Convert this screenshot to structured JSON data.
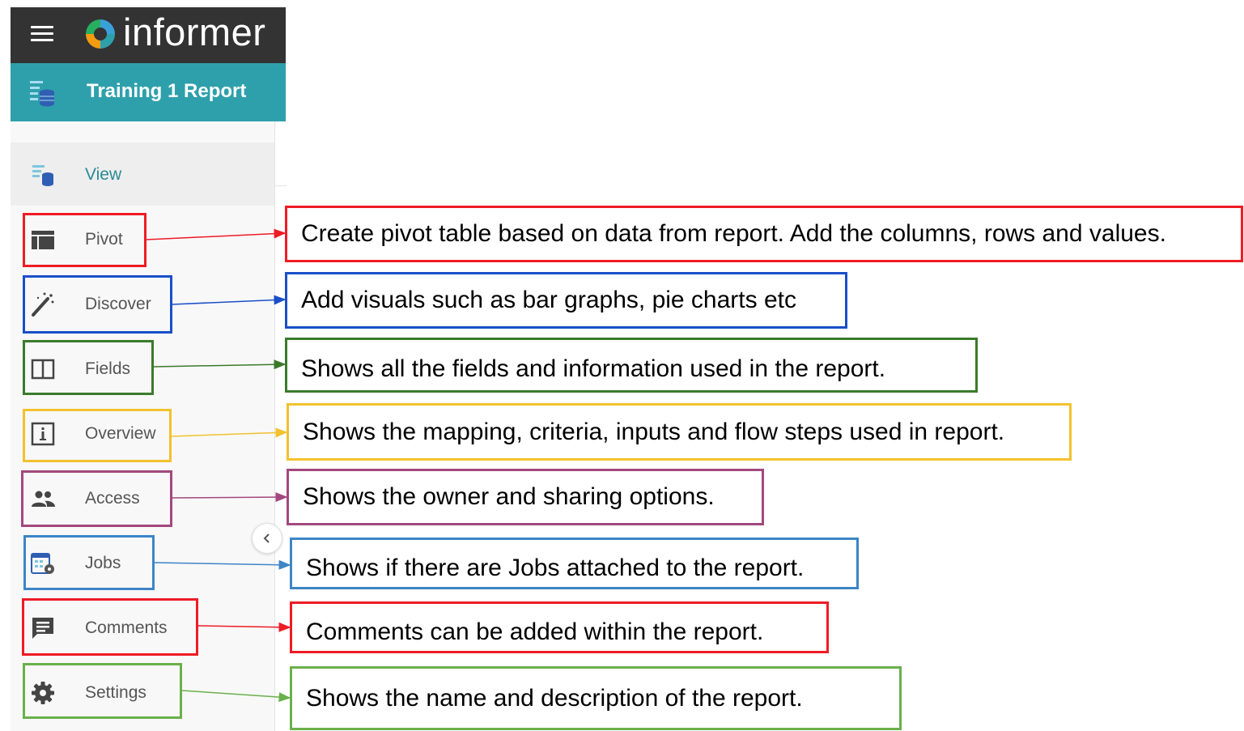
{
  "app": {
    "logo_text": "informer",
    "report_title": "Training 1 Report"
  },
  "nav": {
    "view": "View",
    "pivot": "Pivot",
    "discover": "Discover",
    "fields": "Fields",
    "overview": "Overview",
    "access": "Access",
    "jobs": "Jobs",
    "comments": "Comments",
    "settings": "Settings"
  },
  "annotations": {
    "pivot": "Create pivot table based on data from report. Add the columns, rows and values.",
    "discover": "Add visuals such as bar graphs, pie charts etc",
    "fields": "Shows all the fields and information used in the report.",
    "overview": "Shows the mapping, criteria, inputs and flow steps used in report.",
    "access": "Shows the owner and sharing options.",
    "jobs": "Shows if there are Jobs attached to the report.",
    "comments": "Comments can be added within the report.",
    "settings": "Shows the name and description of the report."
  },
  "colors": {
    "topbar": "#333333",
    "report_header": "#2ea0ab",
    "pivot": "#ee1c25",
    "discover": "#1a4fc8",
    "fields": "#3a7b2a",
    "overview": "#f2c12e",
    "access": "#a3487e",
    "jobs": "#3d85c6",
    "comments": "#ee1c25",
    "settings": "#6ab04c"
  }
}
